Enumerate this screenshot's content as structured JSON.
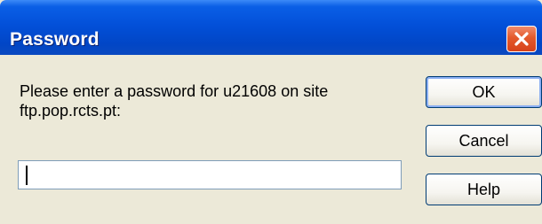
{
  "window": {
    "title": "Password"
  },
  "dialog": {
    "prompt_line1": "Please enter a password for u21608 on site",
    "prompt_line2": "ftp.pop.rcts.pt:",
    "password_value": ""
  },
  "buttons": {
    "ok_label": "OK",
    "cancel_label": "Cancel",
    "help_label": "Help"
  },
  "icons": {
    "close": "close-icon"
  },
  "colors": {
    "titlebar": "#0350d9",
    "close_button": "#e45a2c",
    "dialog_background": "#ece9d8",
    "default_button_border": "#003c74"
  }
}
